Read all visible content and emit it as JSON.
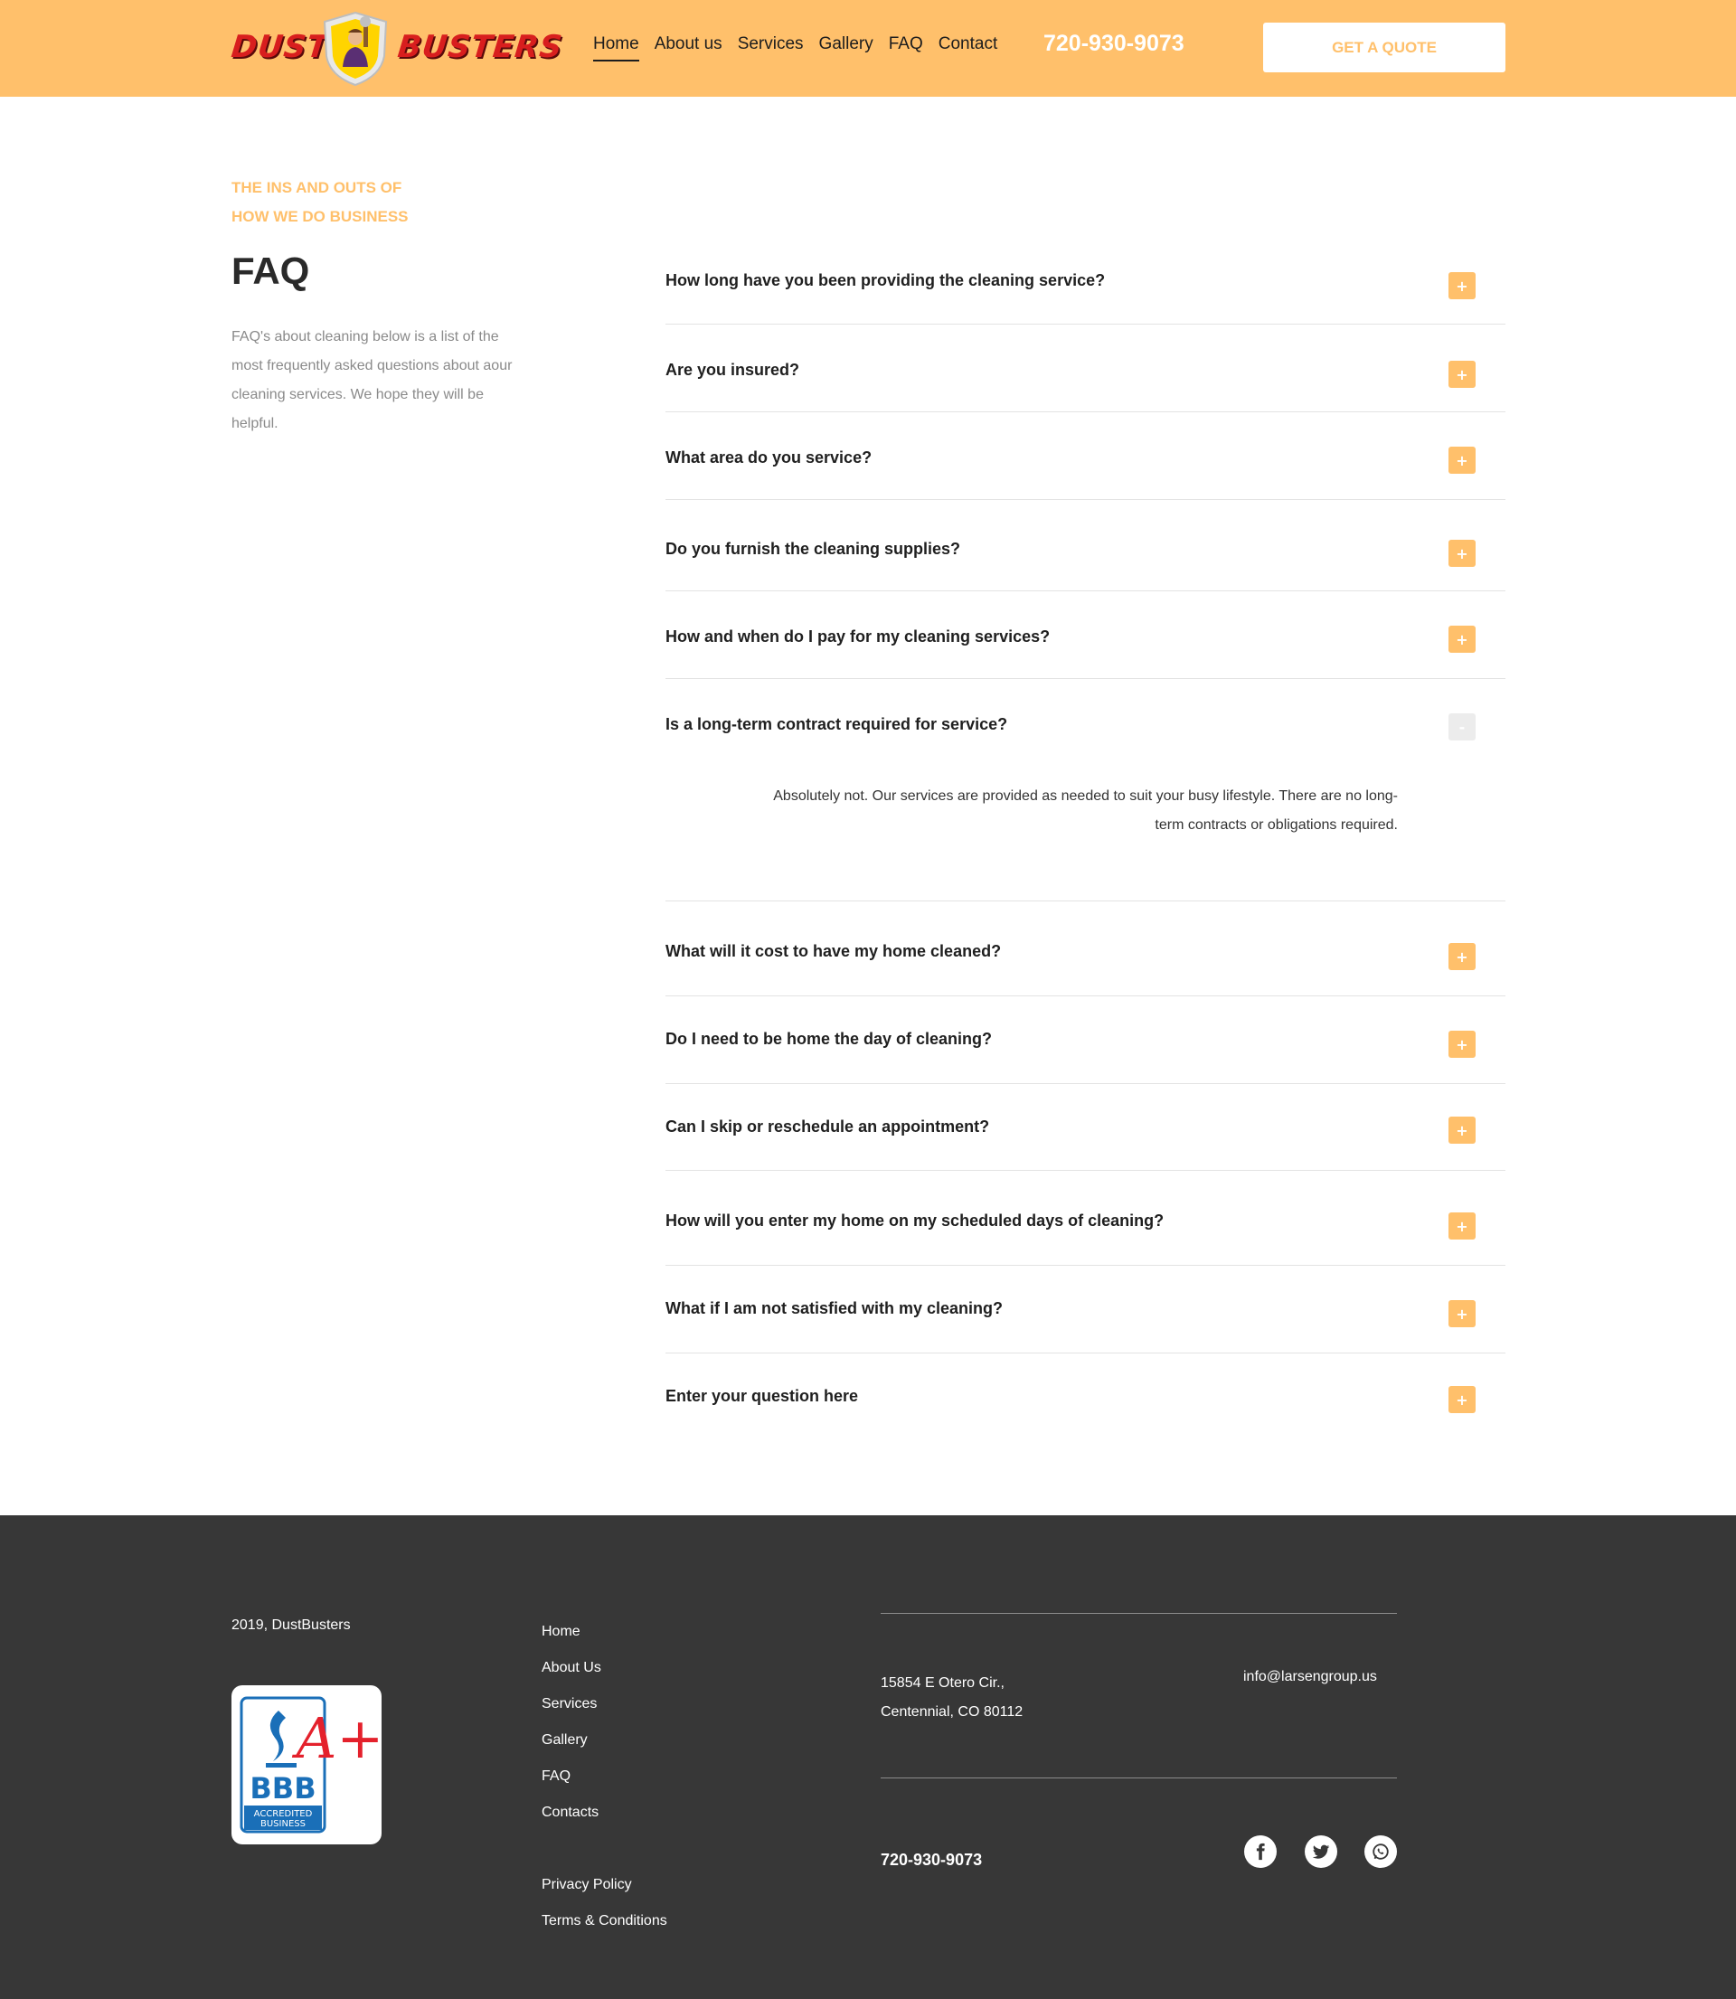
{
  "header": {
    "logo_left": "DUST",
    "logo_right": "BUSTERS",
    "nav": [
      "Home",
      "About us",
      "Services",
      "Gallery",
      "FAQ",
      "Contact"
    ],
    "active_nav": "Home",
    "phone": "720-930-9073",
    "quote_button": "GET A QUOTE"
  },
  "intro": {
    "eyebrow_line1": "THE INS AND OUTS OF",
    "eyebrow_line2": "HOW WE DO BUSINESS",
    "title": "FAQ",
    "description": "FAQ's about cleaning below is a list of the most frequently asked questions about aour cleaning services. We hope they will be helpful."
  },
  "faq": {
    "items": [
      {
        "q": "How long have you been providing the cleaning service?",
        "open": false
      },
      {
        "q": "Are you insured?",
        "open": false
      },
      {
        "q": "What area do you service?",
        "open": false
      },
      {
        "q": "Do you furnish the cleaning supplies?",
        "open": false
      },
      {
        "q": "How and when do I pay for my cleaning services?",
        "open": false
      },
      {
        "q": "Is a long-term contract required for service?",
        "open": true,
        "a": "Absolutely not. Our services are provided as needed to suit your busy lifestyle. There are no long-term contracts or obligations required."
      },
      {
        "q": "What will it cost to have my home cleaned?",
        "open": false
      },
      {
        "q": "Do I need to be home the day of cleaning?",
        "open": false
      },
      {
        "q": "Can I skip or reschedule an appointment?",
        "open": false
      },
      {
        "q": "How will you enter my home on my scheduled days of cleaning?",
        "open": false
      },
      {
        "q": "What if I am not satisfied with my cleaning?",
        "open": false
      },
      {
        "q": "Enter your question here",
        "open": false
      }
    ],
    "plus_symbol": "+",
    "minus_symbol": "-"
  },
  "footer": {
    "copyright": "2019, DustBusters",
    "links": [
      "Home",
      "About Us",
      "Services",
      "Gallery",
      "FAQ",
      "Contacts"
    ],
    "legal": [
      "Privacy Policy",
      "Terms & Conditions"
    ],
    "address_line1": "15854 E Otero Cir.,",
    "address_line2": "Centennial, CO 80112",
    "email": "info@larsengroup.us",
    "phone": "720-930-9073",
    "bbb_letters": "BBB",
    "bbb_caption1": "ACCREDITED",
    "bbb_caption2": "BUSINESS",
    "bbb_grade": "A+",
    "social_icons": [
      "facebook-icon",
      "twitter-icon",
      "whatsapp-icon"
    ]
  },
  "colors": {
    "brand": "#ffc06b",
    "footer_bg": "#373737",
    "logo_red": "#d81e1e",
    "bbb_blue": "#1a6fb8"
  }
}
